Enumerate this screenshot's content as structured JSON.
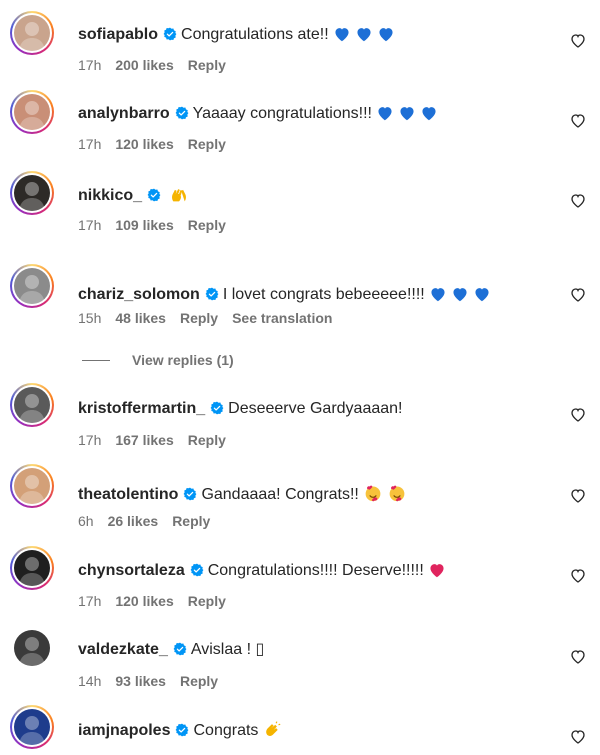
{
  "comments": [
    {
      "username": "sofiapablo",
      "text": "Congratulations ate!!",
      "emoji": [
        "blue-heart",
        "blue-heart",
        "blue-heart"
      ],
      "time": "17h",
      "likes": "200 likes",
      "reply": "Reply",
      "ring": true,
      "avatar_bg": "#c9a48d"
    },
    {
      "username": "analynbarro",
      "text": "Yaaaay congratulations!!!",
      "emoji": [
        "blue-heart",
        "blue-heart",
        "blue-heart"
      ],
      "time": "17h",
      "likes": "120 likes",
      "reply": "Reply",
      "ring": true,
      "avatar_bg": "#c98f77"
    },
    {
      "username": "nikkico_",
      "text": "",
      "emoji": [
        "raising-hands"
      ],
      "time": "17h",
      "likes": "109 likes",
      "reply": "Reply",
      "ring": true,
      "avatar_bg": "#2d2a27"
    },
    {
      "username": "chariz_solomon",
      "text": "I lovet congrats bebeeeee!!!!",
      "emoji": [
        "blue-heart",
        "blue-heart",
        "blue-heart"
      ],
      "time": "15h",
      "likes": "48 likes",
      "reply": "Reply",
      "translate": "See translation",
      "ring": true,
      "avatar_bg": "#8b8b8b"
    },
    {
      "username": "kristoffermartin_",
      "text": "Deseeerve Gardyaaaan!",
      "emoji": [],
      "time": "17h",
      "likes": "167 likes",
      "reply": "Reply",
      "ring": true,
      "avatar_bg": "#5a5a5a"
    },
    {
      "username": "theatolentino",
      "text": "Gandaaaa! Congrats!!",
      "emoji": [
        "smiling-hearts",
        "smiling-hearts"
      ],
      "time": "6h",
      "likes": "26 likes",
      "reply": "Reply",
      "ring": true,
      "avatar_bg": "#d3a078"
    },
    {
      "username": "chynsortaleza",
      "text": "Congratulations!!!! Deserve!!!!!",
      "emoji": [
        "red-heart"
      ],
      "time": "17h",
      "likes": "120 likes",
      "reply": "Reply",
      "ring": true,
      "avatar_bg": "#1f1f1f"
    },
    {
      "username": "valdezkate_",
      "text": "Avislaa ! ▯",
      "emoji": [],
      "time": "14h",
      "likes": "93 likes",
      "reply": "Reply",
      "ring": false,
      "avatar_bg": "#3a3a3a"
    },
    {
      "username": "iamjnapoles",
      "text": "Congrats",
      "emoji": [
        "clapping-hands"
      ],
      "time": "",
      "likes": "",
      "reply": "",
      "ring": true,
      "avatar_bg": "#1e3c8c"
    }
  ],
  "view_replies": "View replies (1)",
  "colors": {
    "verified": "#0095f6",
    "blue_heart": "#1d6fd6",
    "red_heart": "#e0245e",
    "meta": "#737373"
  }
}
